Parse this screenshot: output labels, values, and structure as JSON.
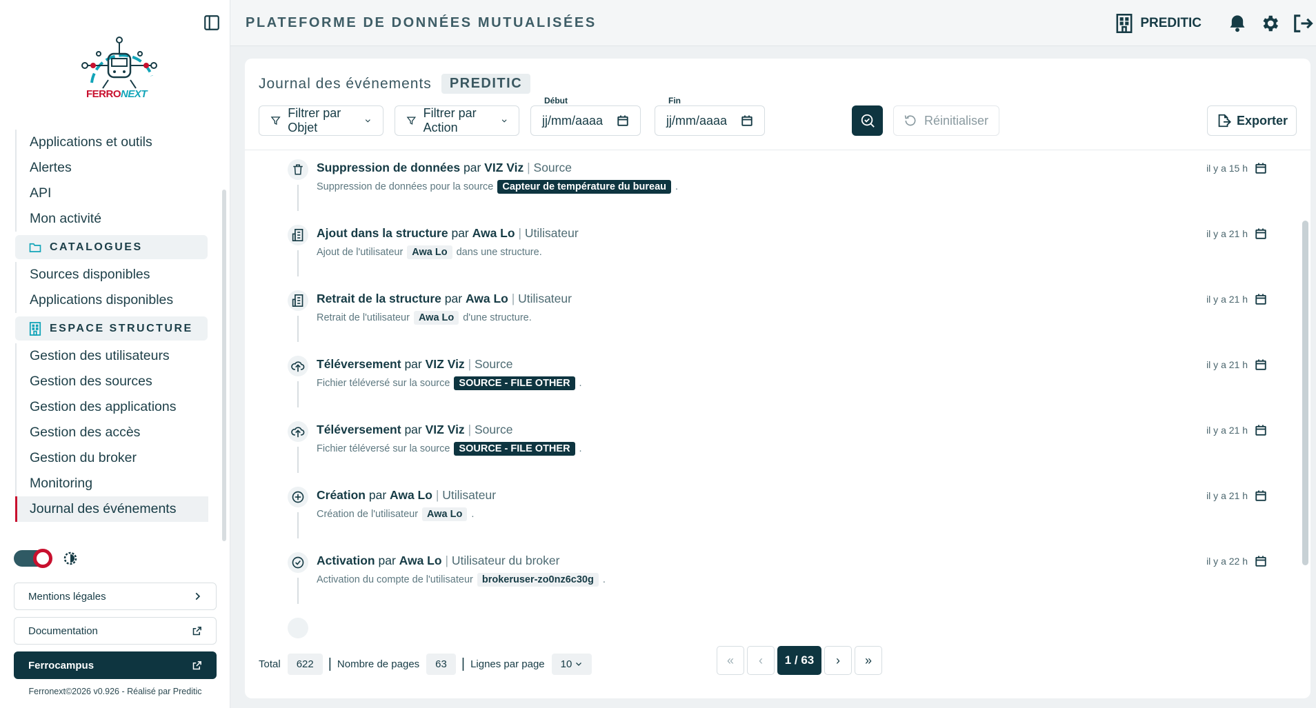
{
  "app": {
    "title": "PLATEFORME DE DONNÉES MUTUALISÉES",
    "organization": "PREDITIC"
  },
  "logo": {
    "part1": "FERRO",
    "part2": "NEXT"
  },
  "sidebar": {
    "top_items": [
      {
        "label": "Applications et outils"
      },
      {
        "label": "Alertes"
      },
      {
        "label": "API"
      },
      {
        "label": "Mon activité"
      }
    ],
    "catalogues_title": "CATALOGUES",
    "catalogues_items": [
      {
        "label": "Sources disponibles"
      },
      {
        "label": "Applications disponibles"
      }
    ],
    "structure_title": "ESPACE STRUCTURE",
    "structure_items": [
      {
        "label": "Gestion des utilisateurs"
      },
      {
        "label": "Gestion des sources"
      },
      {
        "label": "Gestion des applications"
      },
      {
        "label": "Gestion des accès"
      },
      {
        "label": "Gestion du broker"
      },
      {
        "label": "Monitoring"
      },
      {
        "label": "Journal des événements"
      }
    ],
    "legal_label": "Mentions légales",
    "documentation_label": "Documentation",
    "ferrocampus_label": "Ferrocampus",
    "footer": "Ferronext©2026 v0.926 - Réalisé par Preditic"
  },
  "page": {
    "title": "Journal des événements",
    "tag": "PREDITIC"
  },
  "filters": {
    "object_label": "Filtrer par Objet",
    "action_label": "Filtrer par Action",
    "start_label": "Début",
    "start_placeholder": "jj/mm/aaaa",
    "end_label": "Fin",
    "end_placeholder": "jj/mm/aaaa",
    "reset_label": "Réinitialiser",
    "export_label": "Exporter"
  },
  "events": [
    {
      "icon": "trash-icon",
      "action": "Suppression de données",
      "par": "par",
      "actor": "VIZ Viz",
      "type": "Source",
      "desc_before": "Suppression de données pour la source",
      "chip": "Capteur de température du bureau",
      "chip_style": "dark",
      "desc_after": ".",
      "time": "il y a 15 h"
    },
    {
      "icon": "building-icon",
      "action": "Ajout dans la structure",
      "par": "par",
      "actor": "Awa Lo",
      "type": "Utilisateur",
      "desc_before": "Ajout de l'utilisateur",
      "chip": "Awa Lo",
      "chip_style": "light",
      "desc_after": "dans une structure.",
      "time": "il y a 21 h"
    },
    {
      "icon": "building-icon",
      "action": "Retrait de la structure",
      "par": "par",
      "actor": "Awa Lo",
      "type": "Utilisateur",
      "desc_before": "Retrait de l'utilisateur",
      "chip": "Awa Lo",
      "chip_style": "light",
      "desc_after": "d'une structure.",
      "time": "il y a 21 h"
    },
    {
      "icon": "cloud-upload-icon",
      "action": "Téléversement",
      "par": "par",
      "actor": "VIZ Viz",
      "type": "Source",
      "desc_before": "Fichier téléversé sur la source",
      "chip": "SOURCE - FILE OTHER",
      "chip_style": "dark",
      "desc_after": ".",
      "time": "il y a 21 h"
    },
    {
      "icon": "cloud-upload-icon",
      "action": "Téléversement",
      "par": "par",
      "actor": "VIZ Viz",
      "type": "Source",
      "desc_before": "Fichier téléversé sur la source",
      "chip": "SOURCE - FILE OTHER",
      "chip_style": "dark",
      "desc_after": ".",
      "time": "il y a 21 h"
    },
    {
      "icon": "plus-circle-icon",
      "action": "Création",
      "par": "par",
      "actor": "Awa Lo",
      "type": "Utilisateur",
      "desc_before": "Création de l'utilisateur",
      "chip": "Awa Lo",
      "chip_style": "light",
      "desc_after": ".",
      "time": "il y a 21 h"
    },
    {
      "icon": "check-circle-icon",
      "action": "Activation",
      "par": "par",
      "actor": "Awa Lo",
      "type": "Utilisateur du broker",
      "desc_before": "Activation du compte de l'utilisateur",
      "chip": "brokeruser-zo0nz6c30g",
      "chip_style": "light",
      "desc_after": ".",
      "time": "il y a 22 h"
    }
  ],
  "pagination": {
    "total_label": "Total",
    "total": "622",
    "pages_label": "Nombre de pages",
    "pages": "63",
    "rows_label": "Lignes par page",
    "rows": "10",
    "first": "«",
    "prev": "‹",
    "current": "1 / 63",
    "next": "›",
    "last": "»"
  }
}
